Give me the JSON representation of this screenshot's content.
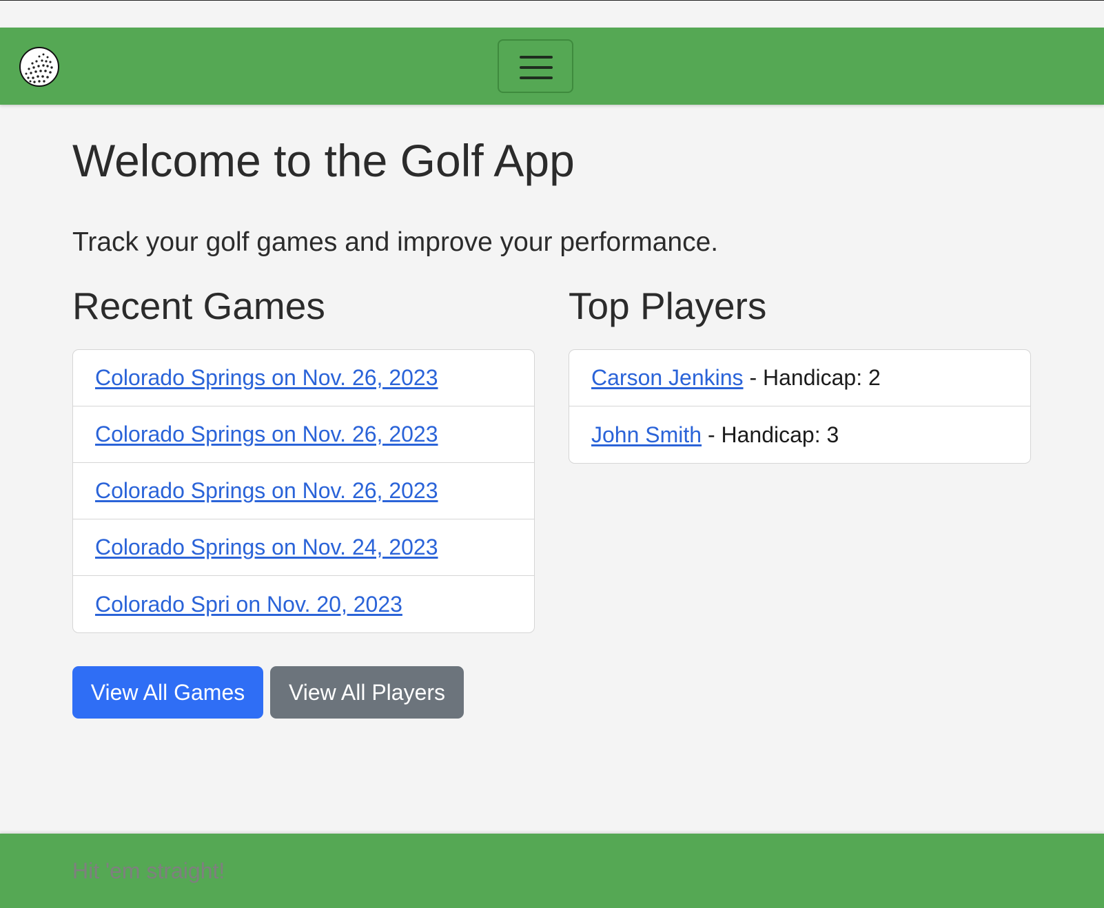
{
  "nav": {
    "logo_icon": "golf-ball-icon",
    "toggler_icon": "hamburger-menu-icon"
  },
  "main": {
    "title": "Welcome to the Golf App",
    "lead": "Track your golf games and improve your performance.",
    "recent_games": {
      "heading": "Recent Games",
      "items": [
        {
          "label": "Colorado Springs on Nov. 26, 2023"
        },
        {
          "label": "Colorado Springs on Nov. 26, 2023"
        },
        {
          "label": "Colorado Springs on Nov. 26, 2023"
        },
        {
          "label": "Colorado Springs on Nov. 24, 2023"
        },
        {
          "label": "Colorado Spri on Nov. 20, 2023"
        }
      ]
    },
    "top_players": {
      "heading": "Top Players",
      "items": [
        {
          "name": "Carson Jenkins",
          "detail": " - Handicap: 2"
        },
        {
          "name": "John Smith",
          "detail": " - Handicap: 3"
        }
      ]
    },
    "buttons": {
      "view_games": "View All Games",
      "view_players": "View All Players"
    }
  },
  "footer": {
    "tagline": "Hit 'em straight!"
  },
  "colors": {
    "brand_green": "#55a854",
    "link_blue": "#2a63d8",
    "primary": "#2f6ef5",
    "secondary": "#6c747c"
  }
}
